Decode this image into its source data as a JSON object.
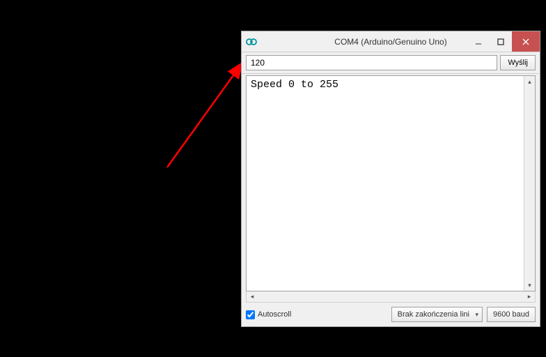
{
  "window": {
    "title": "COM4 (Arduino/Genuino Uno)"
  },
  "input": {
    "value": "120",
    "send_label": "Wyślij"
  },
  "output": {
    "text": "Speed 0 to 255"
  },
  "footer": {
    "autoscroll_label": "Autoscroll",
    "autoscroll_checked": true,
    "line_ending_selected": "Brak zakończenia lini",
    "baud_rate": "9600 baud"
  },
  "annotation": {
    "arrow_color": "#ff0000"
  }
}
